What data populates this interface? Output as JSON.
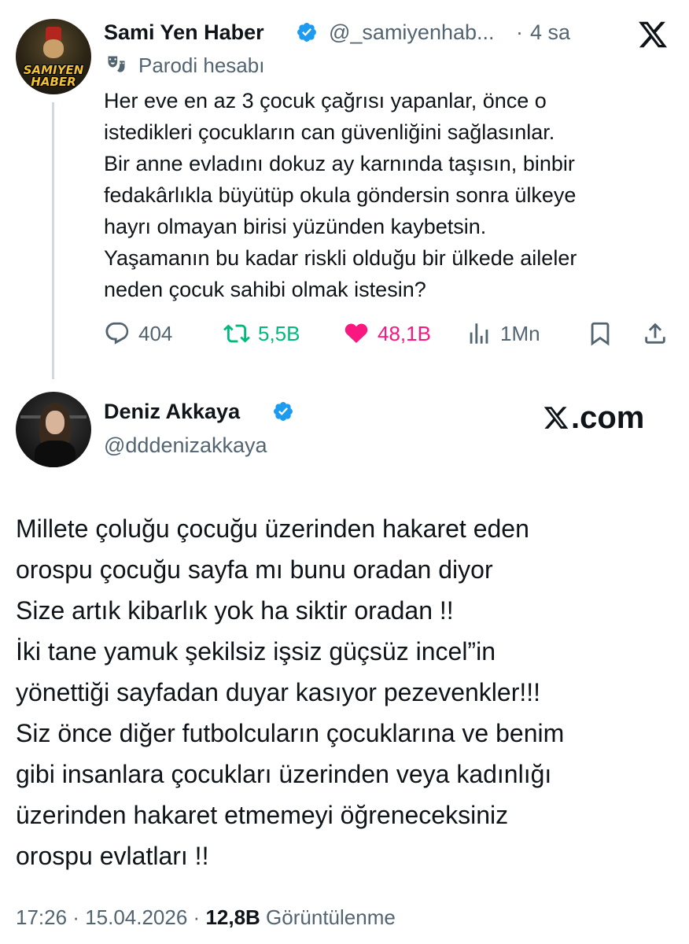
{
  "quoted_tweet": {
    "display_name": "Sami Yen Haber",
    "handle": "@_samiyenhab...",
    "separator": "·",
    "time": "4 sa",
    "avatar_text": "SAMIYEN HABER",
    "label_icon": "theater-masks-icon",
    "label": "Parodi hesabı",
    "text_lines": [
      "Her eve en az 3 çocuk çağrısı yapanlar, önce o",
      "istedikleri çocukların can güvenliğini sağlasınlar.",
      "Bir anne evladını dokuz ay karnında taşısın, binbir",
      "fedakârlıkla büyütüp okula göndersin sonra ülkeye",
      "hayrı olmayan birisi yüzünden kaybetsin.",
      "Yaşamanın bu kadar riskli olduğu bir ülkede aileler",
      "neden çocuk sahibi olmak istesin?"
    ],
    "actions": {
      "replies": "404",
      "retweets": "5,5B",
      "likes": "48,1B",
      "views": "1Mn"
    }
  },
  "main_tweet": {
    "display_name": "Deniz Akkaya",
    "handle": "@dddenizakkaya",
    "watermark": ".com",
    "text_lines": [
      "Millete çoluğu çocuğu üzerinden hakaret eden",
      "orospu çocuğu sayfa mı bunu oradan diyor",
      "Size artık kibarlık yok ha siktir oradan !!",
      "İki tane yamuk şekilsiz işsiz güçsüz  incel”in",
      "yönettiği sayfadan duyar kasıyor pezevenkler!!!",
      "Siz önce diğer futbolcuların çocuklarına ve benim",
      "gibi insanlara çocukları üzerinden veya kadınlığı",
      "üzerinden hakaret etmemeyi öğreneceksiniz",
      "orospu evlatları !!"
    ],
    "meta": {
      "time": "17:26",
      "sep1": " · ",
      "date": "15.04.2026",
      "sep2": " · ",
      "views_count": "12,8B",
      "views_label": " Görüntülenme"
    }
  },
  "colors": {
    "text": "#0f1419",
    "secondary": "#536471",
    "verified": "#1d9bf0",
    "retweet": "#00ba7c",
    "like": "#f91880",
    "thread_line": "#cfd9de"
  }
}
